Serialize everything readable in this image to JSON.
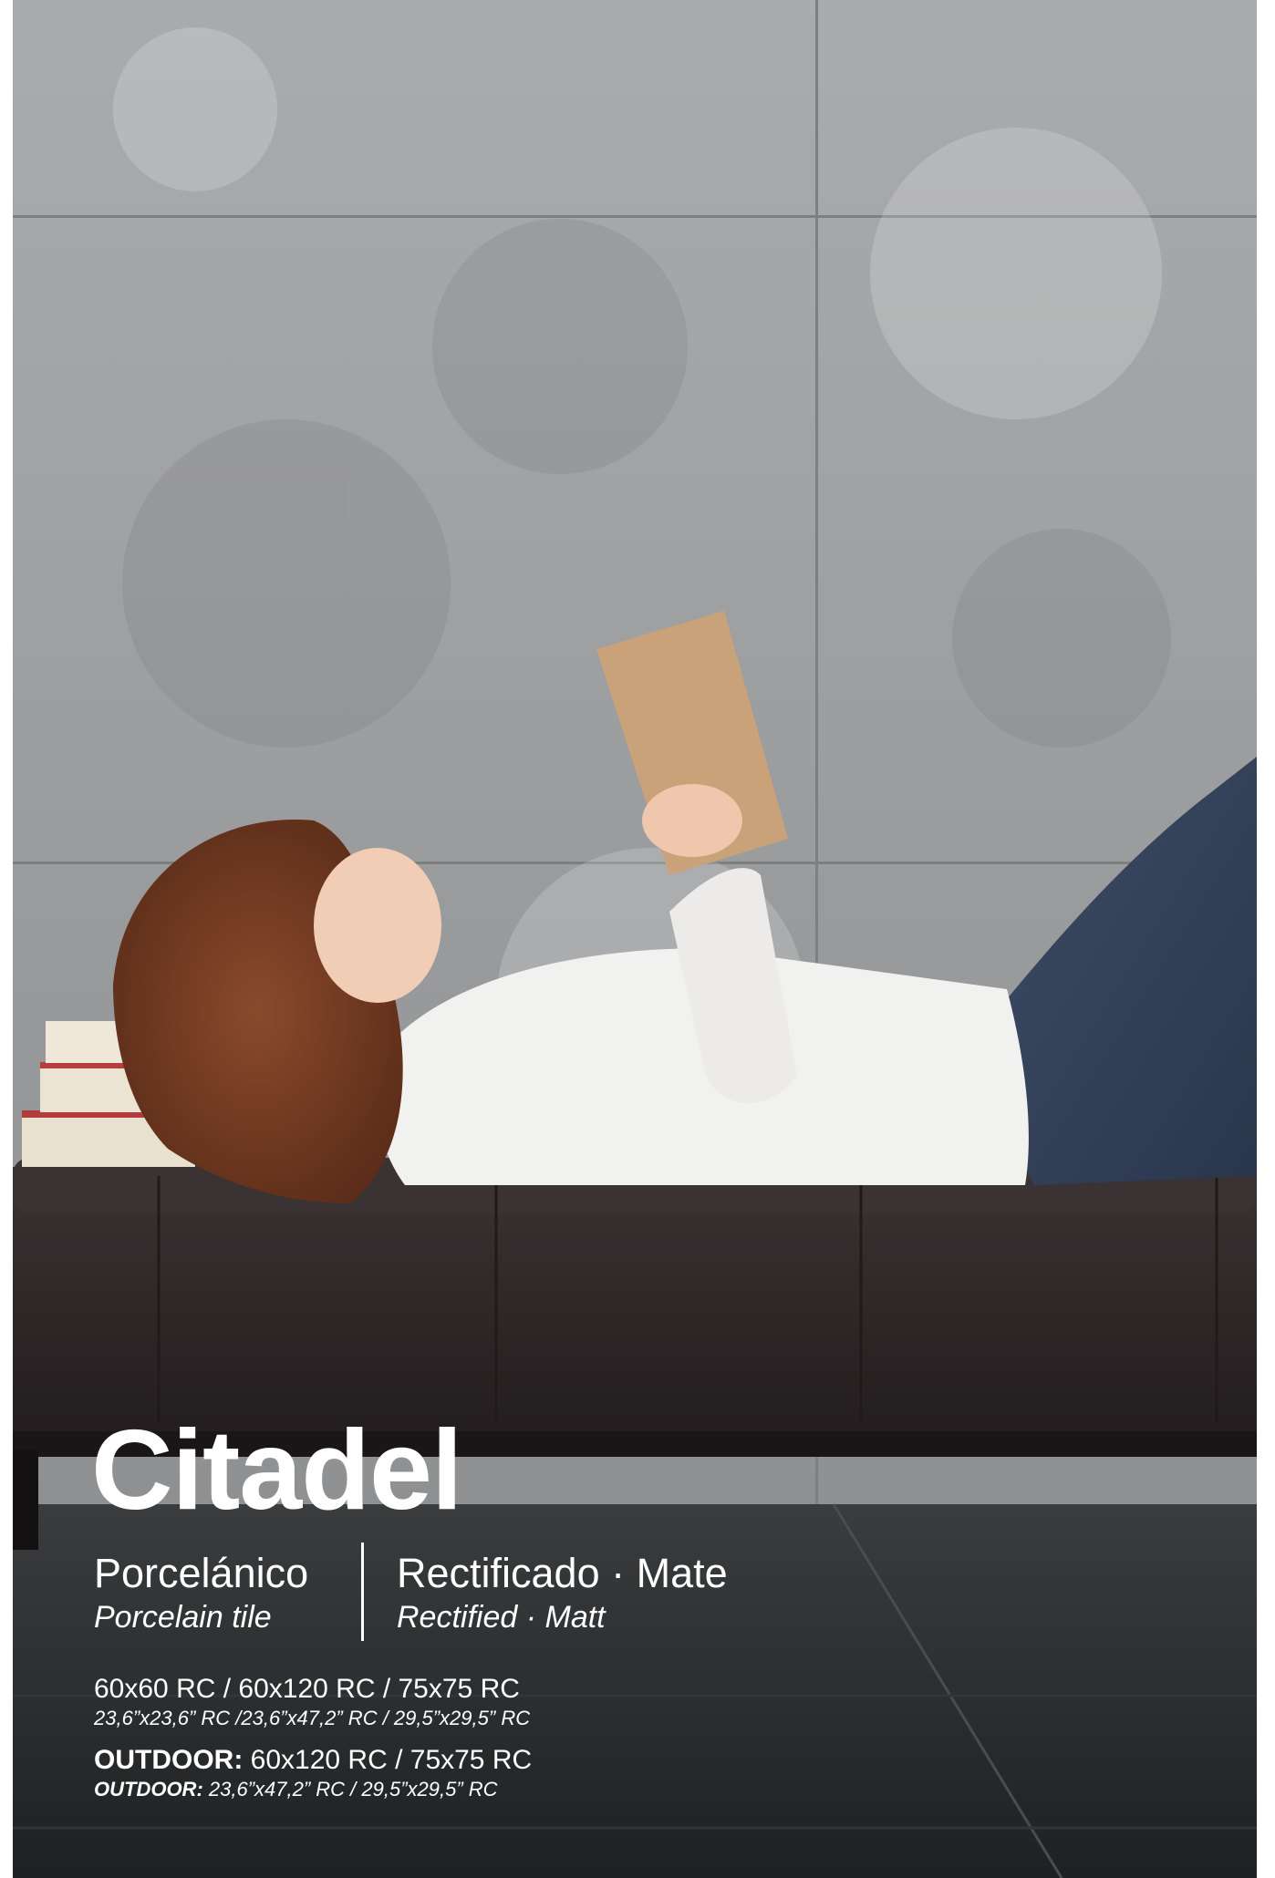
{
  "brand": {
    "title": "Citadel"
  },
  "material": {
    "es": "Porcelánico",
    "en": "Porcelain tile"
  },
  "finish": {
    "es": "Rectificado · Mate",
    "en": "Rectified · Matt"
  },
  "formats": {
    "metric": "60x60 RC / 60x120 RC / 75x75 RC",
    "imperial": "23,6”x23,6” RC /23,6”x47,2” RC / 29,5”x29,5” RC",
    "outdoor_label": "OUTDOOR:",
    "outdoor_metric": " 60x120 RC / 75x75 RC",
    "outdoor_label_sub": "OUTDOOR:",
    "outdoor_imperial": " 23,6”x47,2” RC / 29,5”x29,5” RC"
  },
  "colors": {
    "wall": "#a3a6a8",
    "floor": "#2a2c2e",
    "bench": "#2e2728",
    "text": "#ffffff"
  }
}
